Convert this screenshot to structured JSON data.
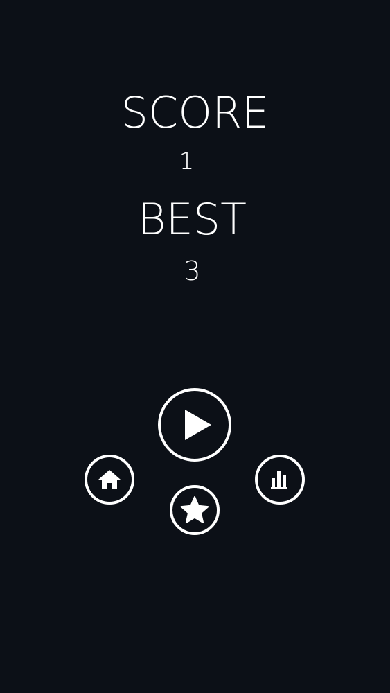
{
  "game_over": {
    "score_label": "SCORE",
    "score_value": "1",
    "best_label": "BEST",
    "best_value": "3"
  },
  "buttons": {
    "play": {
      "icon": "play-icon"
    },
    "home": {
      "icon": "home-icon"
    },
    "rate": {
      "icon": "star-icon"
    },
    "leaderboard": {
      "icon": "leaderboard-icon"
    }
  },
  "colors": {
    "background": "#0c1017",
    "foreground": "#ffffff"
  }
}
